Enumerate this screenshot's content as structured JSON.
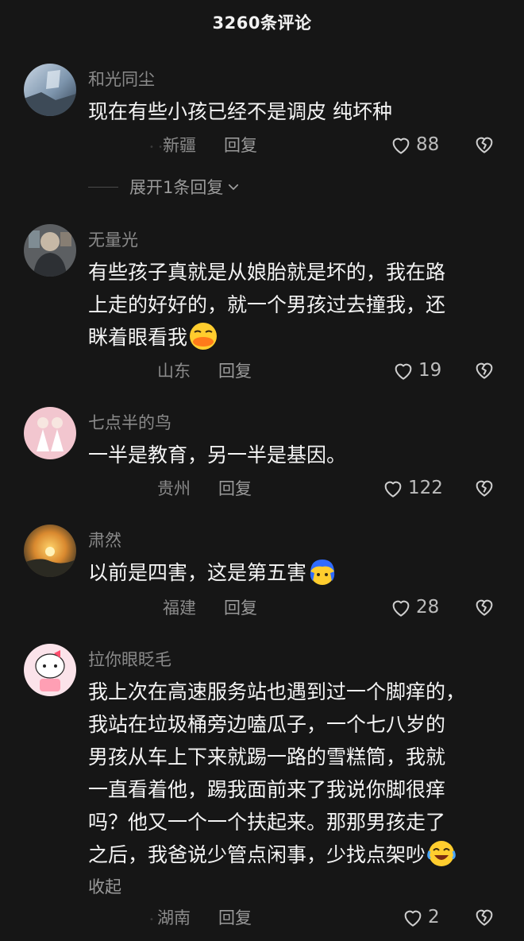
{
  "header": {
    "title": "3260条评论"
  },
  "comments": [
    {
      "username": "和光同尘",
      "lines": [
        "现在有些小孩已经不是调皮 纯坏种"
      ],
      "location": "新疆",
      "reply_label": "回复",
      "likes": "88",
      "expand_label": "展开1条回复"
    },
    {
      "username": "无量光",
      "lines": [
        "有些孩子真就是从娘胎就是坏的，我在路",
        "上走的好好的，就一个男孩过去撞我，还",
        "眯着眼看我"
      ],
      "emoji": "duck-emoji",
      "location": "山东",
      "reply_label": "回复",
      "likes": "19"
    },
    {
      "username": "七点半的鸟",
      "lines": [
        "一半是教育，另一半是基因。"
      ],
      "location": "贵州",
      "reply_label": "回复",
      "likes": "122"
    },
    {
      "username": "肃然",
      "lines": [
        "以前是四害，这是第五害"
      ],
      "emoji": "blue-hair-emoji",
      "location": "福建",
      "reply_label": "回复",
      "likes": "28"
    },
    {
      "username": "拉你眼眨毛",
      "lines": [
        "我上次在高速服务站也遇到过一个脚痒的，",
        "我站在垃圾桶旁边嗑瓜子，一个七八岁的",
        "男孩从车上下来就踢一路的雪糕筒，我就",
        "一直看着他，踢我面前来了我说你脚很痒",
        "吗？他又一个一个扶起来。那那男孩走了",
        "之后，我爸说少管点闲事，少找点架吵"
      ],
      "emoji": "laugh-cry-emoji",
      "collapse_label": "收起",
      "location": "湖南",
      "reply_label": "回复",
      "likes": "2"
    }
  ],
  "colors": {
    "background": "#161616",
    "muted_text": "#8a8a8a",
    "body_text": "#f4f4f4"
  }
}
